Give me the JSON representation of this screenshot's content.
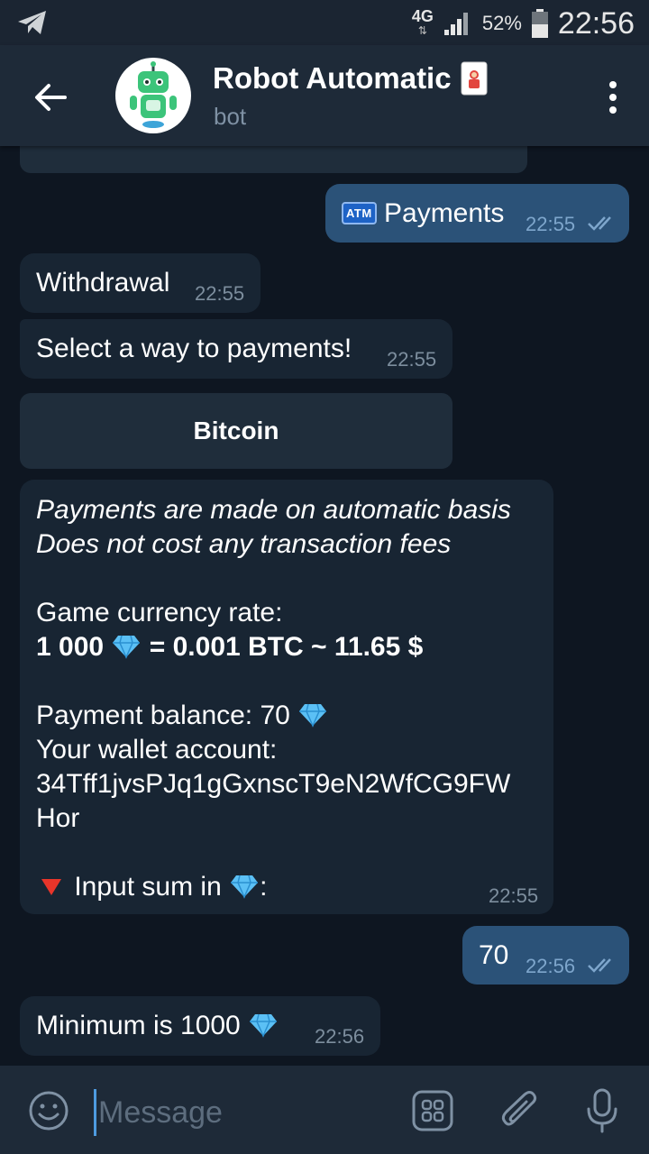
{
  "status_bar": {
    "network": "4G",
    "battery": "52%",
    "time": "22:56"
  },
  "header": {
    "title": "Robot Automatic",
    "subtitle": "bot"
  },
  "messages": {
    "payments_out": {
      "label": "Payments",
      "icon": "atm-icon",
      "atm_text": "ATM",
      "time": "22:55"
    },
    "withdrawal": {
      "text": "Withdrawal",
      "time": "22:55"
    },
    "select_way": {
      "text": "Select a way to payments!",
      "time": "22:55"
    },
    "bitcoin_button": {
      "label": "Bitcoin"
    },
    "info": {
      "line1": "Payments are made on automatic basis",
      "line2": "Does not cost any transaction fees",
      "rate_label": "Game currency rate:",
      "rate_left": "1 000",
      "rate_right": "= 0.001 BTC ~ 11.65 $",
      "balance_label": "Payment balance: 70",
      "wallet_label": "Your wallet account:",
      "wallet_line1": "34Tff1jvsPJq1gGxnscT9eN2WfCG9FW",
      "wallet_line2": "Hor",
      "input_label": "Input sum in",
      "input_suffix": ":",
      "time": "22:55"
    },
    "amount_out": {
      "text": "70",
      "time": "22:56"
    },
    "minimum": {
      "text": "Minimum is 1000",
      "time": "22:56"
    }
  },
  "composer": {
    "placeholder": "Message"
  },
  "colors": {
    "background": "#0e1621",
    "incoming": "#182533",
    "outgoing": "#2b5278",
    "header": "#1e2a38",
    "accent": "#4e9be0"
  }
}
